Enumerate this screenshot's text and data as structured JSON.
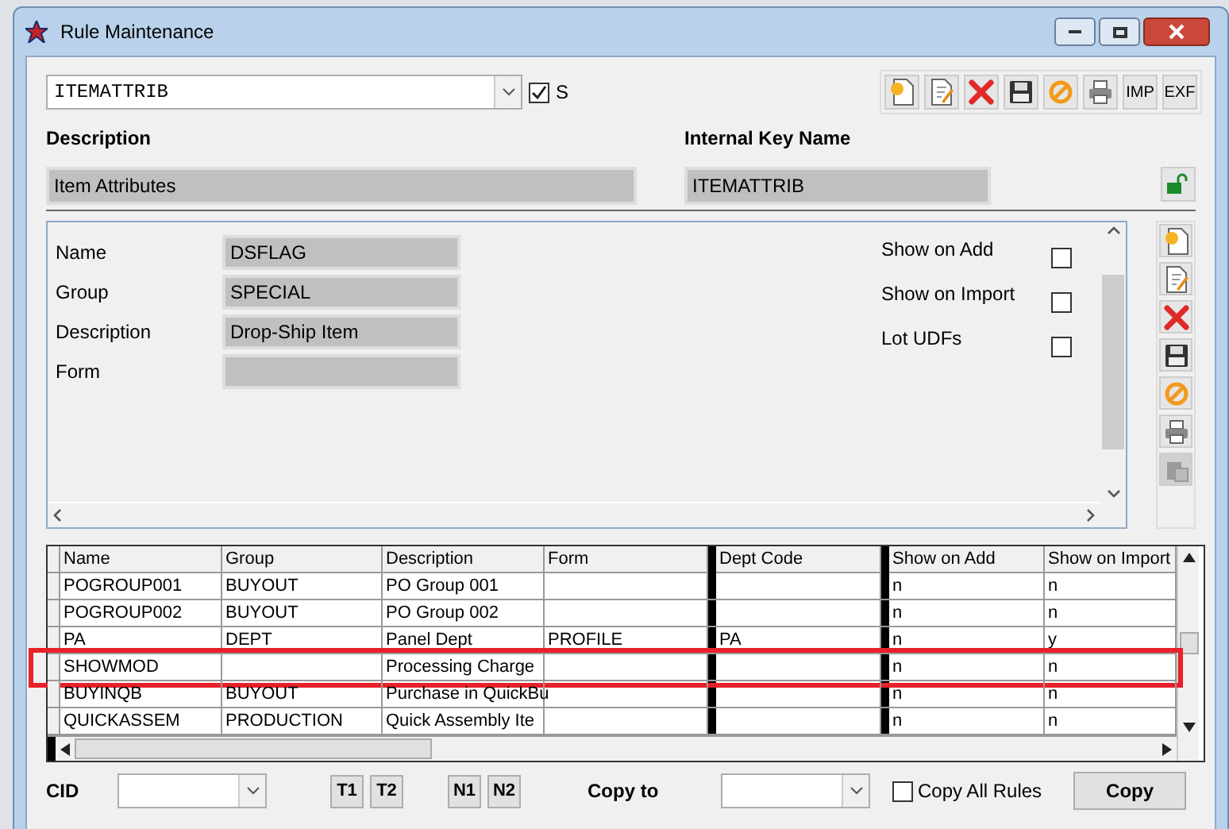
{
  "window": {
    "title": "Rule Maintenance"
  },
  "rule_select": {
    "value": "ITEMATTRIB"
  },
  "s_checkbox": {
    "label": "S",
    "checked": true
  },
  "toolbar": [
    {
      "kind": "new"
    },
    {
      "kind": "edit"
    },
    {
      "kind": "delete"
    },
    {
      "kind": "save"
    },
    {
      "kind": "cancel"
    },
    {
      "kind": "print"
    },
    {
      "kind": "text",
      "label": "IMP"
    },
    {
      "kind": "text",
      "label": "EXF"
    }
  ],
  "description": {
    "label": "Description",
    "value": "Item Attributes"
  },
  "internal_key": {
    "label": "Internal Key Name",
    "value": "ITEMATTRIB",
    "locked": false
  },
  "detail": {
    "fields": [
      {
        "label": "Name",
        "value": "DSFLAG"
      },
      {
        "label": "Group",
        "value": "SPECIAL"
      },
      {
        "label": "Description",
        "value": "Drop-Ship Item"
      },
      {
        "label": "Form"
      }
    ],
    "checks": [
      {
        "label": "Show on Add",
        "checked": false
      },
      {
        "label": "Show on Import",
        "checked": false
      },
      {
        "label": "Lot UDFs",
        "checked": false
      }
    ]
  },
  "side_toolbar": [
    {
      "kind": "new",
      "disabled": false
    },
    {
      "kind": "edit",
      "disabled": false
    },
    {
      "kind": "delete",
      "disabled": false
    },
    {
      "kind": "save",
      "disabled": false
    },
    {
      "kind": "cancel",
      "disabled": false
    },
    {
      "kind": "print",
      "disabled": false
    },
    {
      "kind": "copy",
      "disabled": true
    }
  ],
  "grid": {
    "columns": [
      "Name",
      "Group",
      "Description",
      "Form",
      "Dept Code",
      "Show on Add",
      "Show on Import"
    ],
    "rows": [
      {
        "cells": [
          "POGROUP001",
          "BUYOUT",
          "PO Group 001",
          "",
          "",
          "n",
          "n"
        ],
        "highlighted": false
      },
      {
        "cells": [
          "POGROUP002",
          "BUYOUT",
          "PO Group 002",
          "",
          "",
          "n",
          "n"
        ],
        "highlighted": false
      },
      {
        "cells": [
          "PA",
          "DEPT",
          "Panel Dept",
          "PROFILE",
          "PA",
          "n",
          "y"
        ],
        "highlighted": false
      },
      {
        "cells": [
          "SHOWMOD",
          "",
          "Processing Charge",
          "",
          "",
          "n",
          "n"
        ],
        "highlighted": true
      },
      {
        "cells": [
          "BUYINQB",
          "BUYOUT",
          "Purchase in QuickBu",
          "",
          "",
          "n",
          "n"
        ],
        "highlighted": false
      },
      {
        "cells": [
          "QUICKASSEM",
          "PRODUCTION",
          "Quick Assembly Ite",
          "",
          "",
          "n",
          "n"
        ],
        "highlighted": false
      }
    ]
  },
  "bottom": {
    "cid_label": "CID",
    "buttons": [
      "T1",
      "T2",
      "N1",
      "N2"
    ],
    "copy_to_label": "Copy to",
    "copy_all": {
      "label": "Copy All Rules",
      "checked": false
    },
    "copy_button": "Copy"
  }
}
